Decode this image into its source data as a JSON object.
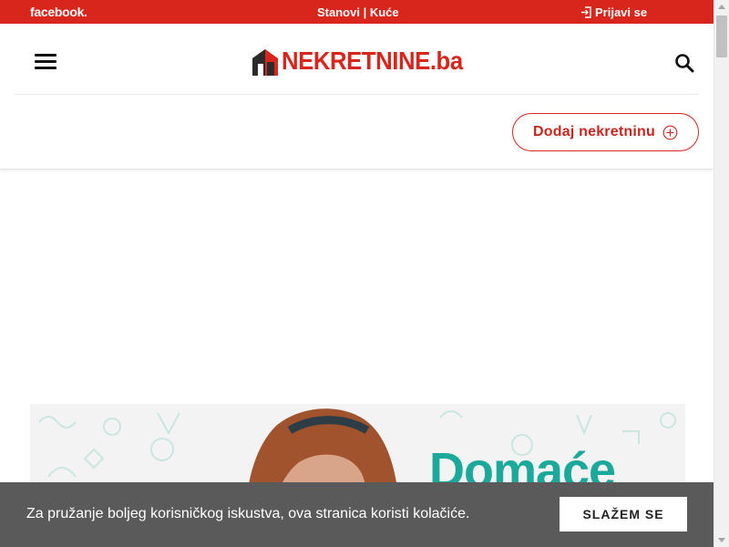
{
  "topbar": {
    "facebook": "facebook.",
    "links": "Stanovi | Kuće",
    "login": "Prijavi se"
  },
  "header": {
    "logo_text": "NEKRETNINE.ba",
    "add_property_label": "Dodaj nekretninu"
  },
  "banner": {
    "headline": "Domaće"
  },
  "cookie": {
    "message": "Za pružanje boljeg korisničkog iskustva, ova stranica koristi kolačiće.",
    "accept_label": "SLAŽEM SE"
  },
  "colors": {
    "brand_red": "#d9261c",
    "cookie_bg": "#5a5a5a",
    "banner_teal": "#1aa99b"
  },
  "icons": [
    "login-icon",
    "menu-icon",
    "logo-house-icon",
    "search-icon",
    "plus-circle-icon"
  ]
}
